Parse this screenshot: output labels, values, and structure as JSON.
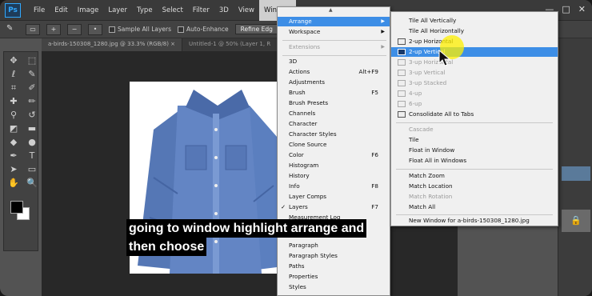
{
  "app": {
    "logo": "Ps"
  },
  "menubar": {
    "items": [
      "File",
      "Edit",
      "Image",
      "Layer",
      "Type",
      "Select",
      "Filter",
      "3D",
      "View",
      "Window"
    ],
    "active_index": 9
  },
  "window_controls": {
    "minimize": "—",
    "maximize": "□",
    "close": "✕"
  },
  "options_bar": {
    "sample_all_layers": "Sample All Layers",
    "auto_enhance": "Auto-Enhance",
    "refine_edge": "Refine Edg"
  },
  "tabs": [
    {
      "label": "a-birds-150308_1280.jpg @ 33.3% (RGB/8) ×"
    },
    {
      "label": "Untitled-1 @ 50% (Layer 1, R"
    }
  ],
  "window_menu": {
    "items": [
      {
        "label": "Arrange",
        "highlight": true,
        "submenu": true
      },
      {
        "label": "Workspace",
        "submenu": true
      },
      {
        "label": "Extensions",
        "disabled": true,
        "submenu": true
      },
      {
        "label": "3D"
      },
      {
        "label": "Actions",
        "shortcut": "Alt+F9"
      },
      {
        "label": "Adjustments"
      },
      {
        "label": "Brush",
        "shortcut": "F5"
      },
      {
        "label": "Brush Presets"
      },
      {
        "label": "Channels"
      },
      {
        "label": "Character"
      },
      {
        "label": "Character Styles"
      },
      {
        "label": "Clone Source"
      },
      {
        "label": "Color",
        "shortcut": "F6"
      },
      {
        "label": "Histogram"
      },
      {
        "label": "History"
      },
      {
        "label": "Info",
        "shortcut": "F8"
      },
      {
        "label": "Layer Comps"
      },
      {
        "label": "Layers",
        "shortcut": "F7",
        "checked": true
      },
      {
        "label": "Measurement Log"
      },
      {
        "label": "Paragraph"
      },
      {
        "label": "Paragraph Styles"
      },
      {
        "label": "Paths"
      },
      {
        "label": "Properties"
      },
      {
        "label": "Styles"
      }
    ],
    "check_mark": "✓",
    "submenu_arrow": "▶"
  },
  "arrange_submenu": {
    "items": [
      {
        "label": "Tile All Vertically"
      },
      {
        "label": "Tile All Horizontally"
      },
      {
        "label": "2-up Horizontal"
      },
      {
        "label": "2-up Vertical",
        "highlight": true
      },
      {
        "label": "3-up Horizontal",
        "disabled": true
      },
      {
        "label": "3-up Vertical",
        "disabled": true
      },
      {
        "label": "3-up Stacked",
        "disabled": true
      },
      {
        "label": "4-up",
        "disabled": true
      },
      {
        "label": "6-up",
        "disabled": true
      },
      {
        "label": "Consolidate All to Tabs"
      },
      {
        "label": "Cascade",
        "disabled": true
      },
      {
        "label": "Tile"
      },
      {
        "label": "Float in Window"
      },
      {
        "label": "Float All in Windows"
      },
      {
        "label": "Match Zoom"
      },
      {
        "label": "Match Location"
      },
      {
        "label": "Match Rotation",
        "disabled": true
      },
      {
        "label": "Match All"
      },
      {
        "label": "New Window for a-birds-150308_1280.jpg"
      }
    ]
  },
  "subtitle": {
    "line1": "going to window highlight arrange and",
    "line2": "then choose"
  },
  "colors": {
    "menu_highlight": "#3d8ee6",
    "yellow_cursor_highlight": "#fff000",
    "shirt_blue": "#5b7fbf"
  }
}
